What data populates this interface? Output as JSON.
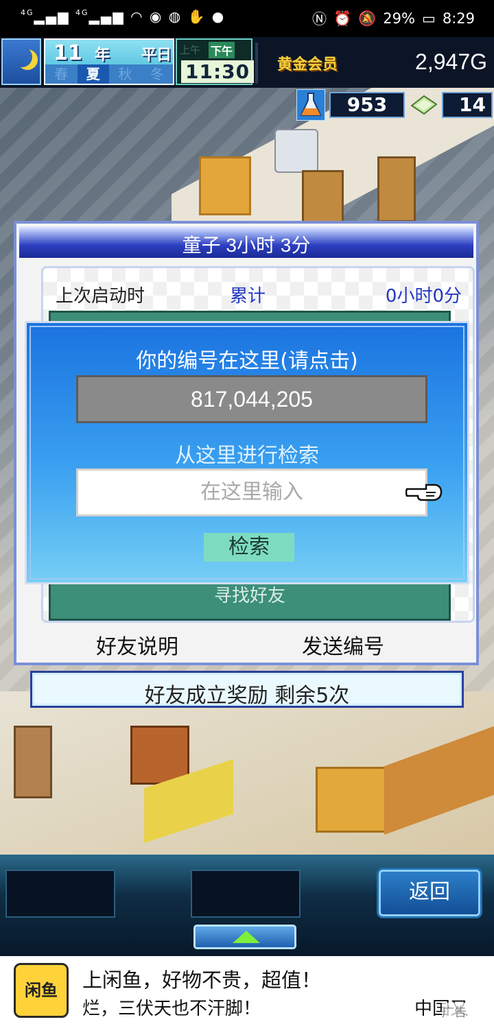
{
  "status_bar": {
    "network": "4G",
    "network_2": "4G",
    "battery": "29%",
    "time": "8:29"
  },
  "hud": {
    "year": "11",
    "year_unit": "年",
    "weekday": "平日",
    "seasons": [
      "春",
      "夏",
      "秋",
      "冬"
    ],
    "active_season": "夏",
    "am_label": "上午",
    "pm_label": "下午",
    "clock": "11:30",
    "member_badge": "黄金会员",
    "gold": "2,947G",
    "flask_count": "953",
    "ticket_count": "14",
    "icons": [
      "moon-icon",
      "flask-icon",
      "ticket-icon"
    ]
  },
  "friend_panel": {
    "title": "童子  3小时 3分",
    "last_launch_label": "上次启动时",
    "accum_label": "累计",
    "accum_value": "0小时0分",
    "find_friend_label": "寻找好友",
    "friend_help_label": "好友说明",
    "send_number_label": "发送编号",
    "bonus_text": "好友成立奖励  剩余5次"
  },
  "search_popup": {
    "your_number_label": "你的编号在这里(请点击)",
    "your_number": "817,044,205",
    "search_from_label": "从这里进行检索",
    "input_placeholder": "在这里输入",
    "search_button": "检索"
  },
  "bottom_bar": {
    "back_button": "返回"
  },
  "ad": {
    "logo_text": "闲鱼",
    "line_1": "上闲鱼，好物不贵，超值！",
    "line_2": "烂，三伏天也不汗脚！",
    "brand": "中国又",
    "tag": "广告"
  },
  "colors": {
    "panel_header": "#1c2a96",
    "popup_bg": "#3aa0f0",
    "accent_blue": "#2237c4",
    "gold_text": "#f4d23a",
    "search_button_bg": "#7ddcc0"
  }
}
